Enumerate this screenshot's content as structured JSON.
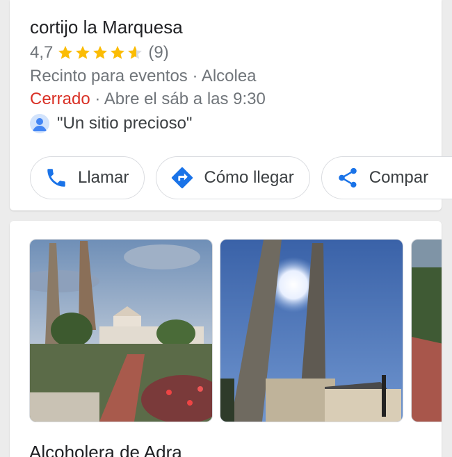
{
  "place": {
    "name": "cortijo la Marquesa",
    "rating": "4,7",
    "rating_value": 4.7,
    "stars_max": 5,
    "review_count": "(9)",
    "category_line": "Recinto para eventos · Alcolea",
    "status_closed": "Cerrado",
    "status_rest": " · Abre el sáb a las 9:30",
    "review_snippet": "\"Un sitio precioso\""
  },
  "actions": [
    {
      "label": "Llamar",
      "icon": "phone-icon"
    },
    {
      "label": "Cómo llegar",
      "icon": "directions-icon"
    },
    {
      "label": "Compar",
      "icon": "share-icon"
    }
  ],
  "photos": [
    {
      "name": "photo-chimneys-garden"
    },
    {
      "name": "photo-chimneys-sun"
    },
    {
      "name": "photo-garden-path"
    }
  ],
  "next_section_title": "Alcoholera de Adra",
  "colors": {
    "star": "#fbbc04",
    "closed": "#d93025",
    "icon_blue": "#1a73e8",
    "secondary_text": "#70757a"
  }
}
